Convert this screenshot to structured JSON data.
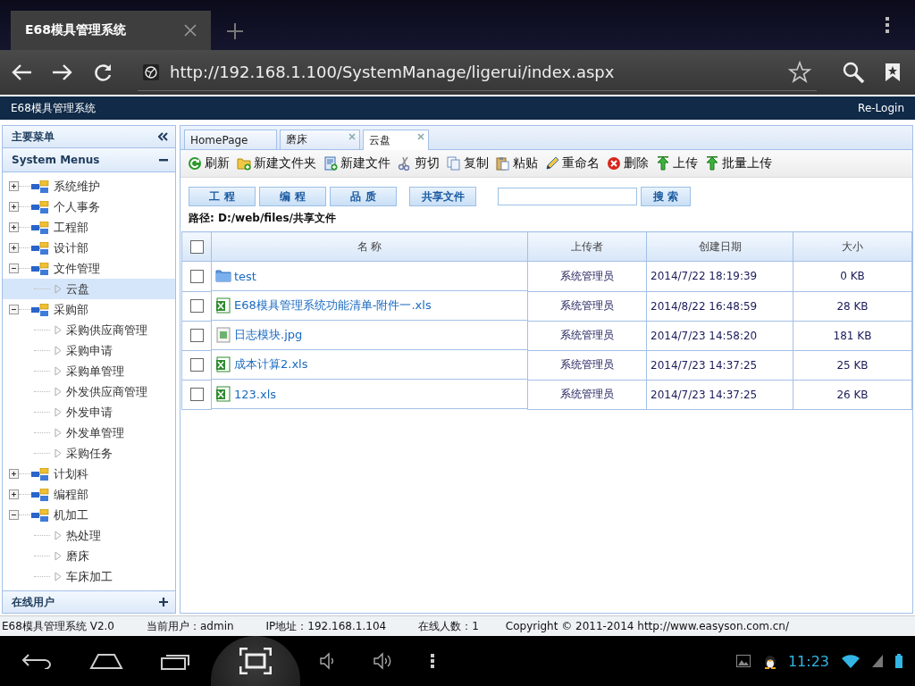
{
  "browser": {
    "tab_title": "E68模具管理系统",
    "url": "http://192.168.1.100/SystemManage/ligerui/index.aspx"
  },
  "app_header": {
    "title": "E68模具管理系统",
    "relogin": "Re-Login"
  },
  "sidebar": {
    "title": "主要菜单",
    "section": "System Menus",
    "footer": "在线用户",
    "tree": [
      {
        "label": "系统维护",
        "expanded": false,
        "selected": false
      },
      {
        "label": "个人事务",
        "expanded": false,
        "selected": false
      },
      {
        "label": "工程部",
        "expanded": false,
        "selected": false
      },
      {
        "label": "设计部",
        "expanded": false,
        "selected": false
      },
      {
        "label": "文件管理",
        "expanded": true,
        "selected": false,
        "children": [
          {
            "label": "云盘",
            "selected": true
          }
        ]
      },
      {
        "label": "采购部",
        "expanded": true,
        "selected": false,
        "children": [
          {
            "label": "采购供应商管理",
            "selected": false
          },
          {
            "label": "采购申请",
            "selected": false
          },
          {
            "label": "采购单管理",
            "selected": false
          },
          {
            "label": "外发供应商管理",
            "selected": false
          },
          {
            "label": "外发申请",
            "selected": false
          },
          {
            "label": "外发单管理",
            "selected": false
          },
          {
            "label": "采购任务",
            "selected": false
          }
        ]
      },
      {
        "label": "计划科",
        "expanded": false,
        "selected": false
      },
      {
        "label": "编程部",
        "expanded": false,
        "selected": false
      },
      {
        "label": "机加工",
        "expanded": true,
        "selected": false,
        "children": [
          {
            "label": "热处理",
            "selected": false
          },
          {
            "label": "磨床",
            "selected": false
          },
          {
            "label": "车床加工",
            "selected": false
          }
        ]
      }
    ]
  },
  "tabs": [
    {
      "label": "HomePage",
      "selected": false,
      "closable": false
    },
    {
      "label": "磨床",
      "selected": false,
      "closable": true
    },
    {
      "label": "云盘",
      "selected": true,
      "closable": true
    }
  ],
  "toolbar": [
    {
      "label": "刷新",
      "kind": "refresh"
    },
    {
      "label": "新建文件夹",
      "kind": "new-folder"
    },
    {
      "label": "新建文件",
      "kind": "new-file"
    },
    {
      "label": "剪切",
      "kind": "cut"
    },
    {
      "label": "复制",
      "kind": "copy"
    },
    {
      "label": "粘贴",
      "kind": "paste"
    },
    {
      "label": "重命名",
      "kind": "rename"
    },
    {
      "label": "删除",
      "kind": "delete"
    },
    {
      "label": "上传",
      "kind": "upload"
    },
    {
      "label": "批量上传",
      "kind": "upload"
    }
  ],
  "filter_buttons": [
    "工 程",
    "编 程",
    "品 质",
    "共享文件"
  ],
  "search_button": "搜 索",
  "path": "路径: D:/web/files/共享文件",
  "table": {
    "select_all_checked": false,
    "columns": [
      "名 称",
      "上传者",
      "创建日期",
      "大小"
    ],
    "rows": [
      {
        "kind": "folder",
        "name": "test",
        "uploader": "系统管理员",
        "date": "2014/7/22 18:19:39",
        "size": "0 KB",
        "checked": false
      },
      {
        "kind": "excel",
        "name": "E68模具管理系统功能清单-附件一.xls",
        "uploader": "系统管理员",
        "date": "2014/8/22 16:48:59",
        "size": "28 KB",
        "checked": false
      },
      {
        "kind": "image",
        "name": "日志模块.jpg",
        "uploader": "系统管理员",
        "date": "2014/7/23 14:58:20",
        "size": "181 KB",
        "checked": false
      },
      {
        "kind": "excel",
        "name": "成本计算2.xls",
        "uploader": "系统管理员",
        "date": "2014/7/23 14:37:25",
        "size": "25 KB",
        "checked": false
      },
      {
        "kind": "excel",
        "name": "123.xls",
        "uploader": "系统管理员",
        "date": "2014/7/23 14:37:25",
        "size": "26 KB",
        "checked": false
      }
    ]
  },
  "status_bar": [
    "E68模具管理系统 V2.0",
    "当前用户：admin",
    "IP地址：192.168.1.104",
    "在线人数：1",
    "Copyright © 2011-2014 http://www.easyson.com.cn/"
  ],
  "system_bar": {
    "time": "11:23"
  }
}
